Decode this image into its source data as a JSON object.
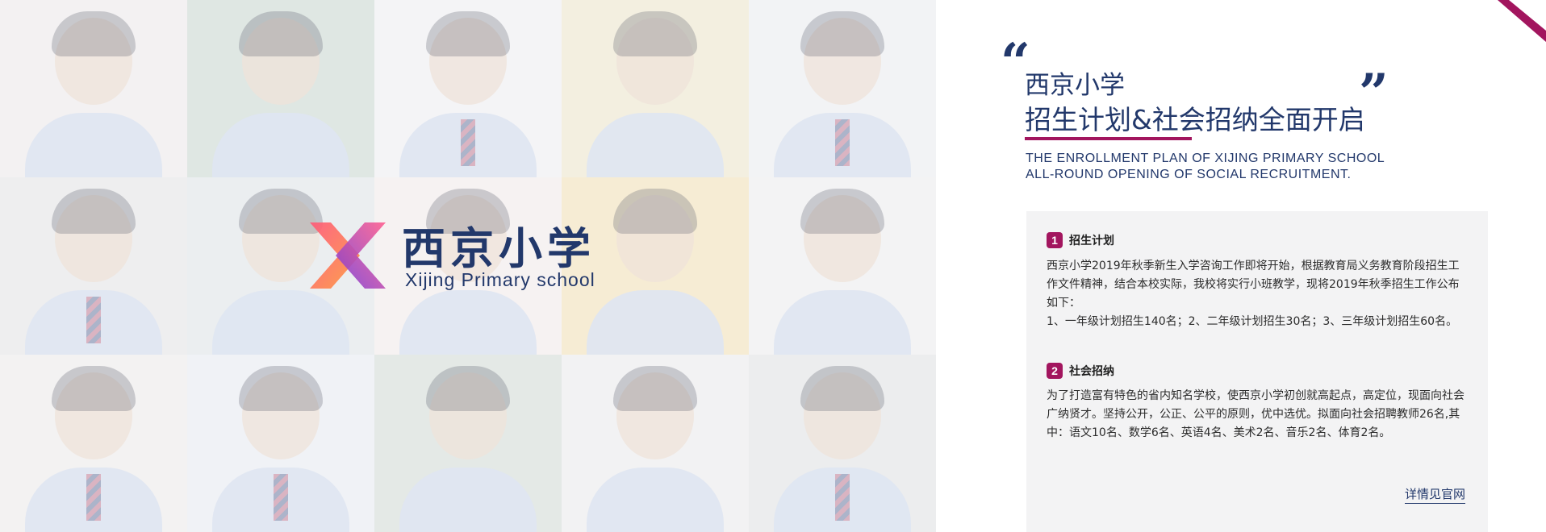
{
  "logo": {
    "name_cn": "西京小学",
    "name_en": "Xijing Primary school"
  },
  "headline": {
    "quote_open": "“",
    "quote_close": "”",
    "line1": "西京小学",
    "line2": "招生计划&社会招纳全面开启",
    "en_line1": "THE ENROLLMENT PLAN OF XIJING PRIMARY SCHOOL",
    "en_line2": "ALL-ROUND OPENING OF SOCIAL RECRUITMENT."
  },
  "sections": [
    {
      "number": "1",
      "title": "招生计划",
      "text1": "西京小学2019年秋季新生入学咨询工作即将开始，根据教育局义务教育阶段招生工作文件精神，结合本校实际，我校将实行小班教学，现将2019年秋季招生工作公布如下：",
      "text2": "1、一年级计划招生140名；2、二年级计划招生30名；3、三年级计划招生60名。"
    },
    {
      "number": "2",
      "title": "社会招纳",
      "text1": "为了打造富有特色的省内知名学校，使西京小学初创就高起点，高定位，现面向社会广纳贤才。坚持公开，公正、公平的原则，优中选优。拟面向社会招聘教师26名,其中：语文10名、数学6名、英语4名、美术2名、音乐2名、体育2名。"
    }
  ],
  "more_link": "详情见官网",
  "colors": {
    "navy": "#22386b",
    "magenta": "#a2155e",
    "card_bg": "#f3f3f4"
  },
  "photo_tiles": [
    {
      "bg": "#f3f1f2",
      "tie": false
    },
    {
      "bg": "#dfe7e3",
      "tie": false
    },
    {
      "bg": "#f4f4f6",
      "tie": true
    },
    {
      "bg": "#f3efe0",
      "tie": false
    },
    {
      "bg": "#f2f3f5",
      "tie": true
    },
    {
      "bg": "#eeeeef",
      "tie": true
    },
    {
      "bg": "#ebeef0",
      "tie": false
    },
    {
      "bg": "#f6f2f2",
      "tie": false
    },
    {
      "bg": "#f6ecd4",
      "tie": false
    },
    {
      "bg": "#f3f3f4",
      "tie": false
    },
    {
      "bg": "#f3f2f2",
      "tie": true
    },
    {
      "bg": "#f0f2f6",
      "tie": true
    },
    {
      "bg": "#e4e9e6",
      "tie": false
    },
    {
      "bg": "#f2f2f3",
      "tie": false
    },
    {
      "bg": "#ecedee",
      "tie": true
    }
  ]
}
